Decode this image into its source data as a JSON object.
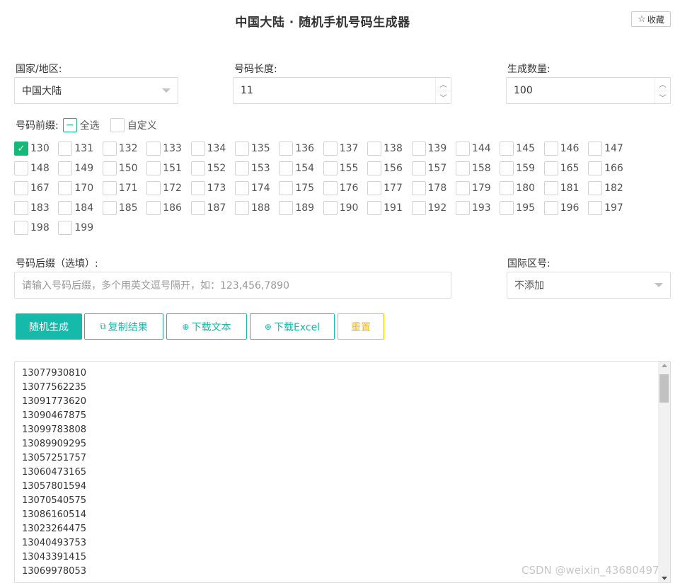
{
  "title": "中国大陆 · 随机手机号码生成器",
  "favorite": {
    "icon": "star-outline-icon",
    "label": "收藏"
  },
  "form": {
    "region": {
      "label": "国家/地区:",
      "value": "中国大陆"
    },
    "length": {
      "label": "号码长度:",
      "value": "11"
    },
    "count": {
      "label": "生成数量:",
      "value": "100"
    },
    "prefix": {
      "label": "号码前缀:",
      "select_all": "全选",
      "custom": "自定义",
      "options": [
        {
          "n": "130",
          "c": true
        },
        {
          "n": "131",
          "c": false
        },
        {
          "n": "132",
          "c": false
        },
        {
          "n": "133",
          "c": false
        },
        {
          "n": "134",
          "c": false
        },
        {
          "n": "135",
          "c": false
        },
        {
          "n": "136",
          "c": false
        },
        {
          "n": "137",
          "c": false
        },
        {
          "n": "138",
          "c": false
        },
        {
          "n": "139",
          "c": false
        },
        {
          "n": "144",
          "c": false
        },
        {
          "n": "145",
          "c": false
        },
        {
          "n": "146",
          "c": false
        },
        {
          "n": "147",
          "c": false
        },
        {
          "n": "148",
          "c": false
        },
        {
          "n": "149",
          "c": false
        },
        {
          "n": "150",
          "c": false
        },
        {
          "n": "151",
          "c": false
        },
        {
          "n": "152",
          "c": false
        },
        {
          "n": "153",
          "c": false
        },
        {
          "n": "154",
          "c": false
        },
        {
          "n": "155",
          "c": false
        },
        {
          "n": "156",
          "c": false
        },
        {
          "n": "157",
          "c": false
        },
        {
          "n": "158",
          "c": false
        },
        {
          "n": "159",
          "c": false
        },
        {
          "n": "165",
          "c": false
        },
        {
          "n": "166",
          "c": false
        },
        {
          "n": "167",
          "c": false
        },
        {
          "n": "170",
          "c": false
        },
        {
          "n": "171",
          "c": false
        },
        {
          "n": "172",
          "c": false
        },
        {
          "n": "173",
          "c": false
        },
        {
          "n": "174",
          "c": false
        },
        {
          "n": "175",
          "c": false
        },
        {
          "n": "176",
          "c": false
        },
        {
          "n": "177",
          "c": false
        },
        {
          "n": "178",
          "c": false
        },
        {
          "n": "179",
          "c": false
        },
        {
          "n": "180",
          "c": false
        },
        {
          "n": "181",
          "c": false
        },
        {
          "n": "182",
          "c": false
        },
        {
          "n": "183",
          "c": false
        },
        {
          "n": "184",
          "c": false
        },
        {
          "n": "185",
          "c": false
        },
        {
          "n": "186",
          "c": false
        },
        {
          "n": "187",
          "c": false
        },
        {
          "n": "188",
          "c": false
        },
        {
          "n": "189",
          "c": false
        },
        {
          "n": "190",
          "c": false
        },
        {
          "n": "191",
          "c": false
        },
        {
          "n": "192",
          "c": false
        },
        {
          "n": "193",
          "c": false
        },
        {
          "n": "195",
          "c": false
        },
        {
          "n": "196",
          "c": false
        },
        {
          "n": "197",
          "c": false
        },
        {
          "n": "198",
          "c": false
        },
        {
          "n": "199",
          "c": false
        }
      ]
    },
    "suffix": {
      "label": "号码后缀（选填）:",
      "placeholder": "请输入号码后缀，多个用英文逗号隔开，如：123,456,7890"
    },
    "country_code": {
      "label": "国际区号:",
      "value": "不添加"
    }
  },
  "buttons": {
    "generate": "随机生成",
    "copy": "复制结果",
    "download_text": "下载文本",
    "download_excel": "下载Excel",
    "reset": "重置"
  },
  "results": [
    "13077930810",
    "13077562235",
    "13091773620",
    "13090467875",
    "13099783808",
    "13089909295",
    "13057251757",
    "13060473165",
    "13057801594",
    "13070540575",
    "13086160514",
    "13023264475",
    "13040493753",
    "13043391415",
    "13069978053"
  ],
  "watermark": "CSDN @weixin_43680497"
}
